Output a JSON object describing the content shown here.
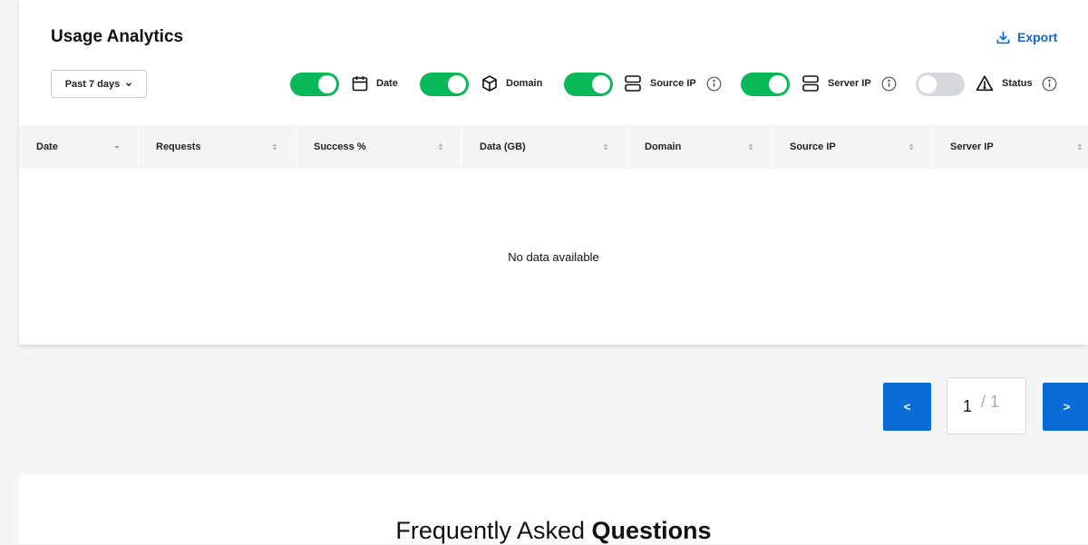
{
  "header": {
    "title": "Usage Analytics",
    "export_label": "Export",
    "accent_color": "#0a6cd8"
  },
  "range": {
    "label": "Past 7 days",
    "icon": "chevron-down-icon"
  },
  "filters": [
    {
      "label": "Date",
      "icon": "calendar-icon",
      "enabled": true,
      "has_info": false
    },
    {
      "label": "Domain",
      "icon": "cube-icon",
      "enabled": true,
      "has_info": false
    },
    {
      "label": "Source IP",
      "icon": "server-icon",
      "enabled": true,
      "has_info": true
    },
    {
      "label": "Server IP",
      "icon": "server-icon",
      "enabled": true,
      "has_info": true
    },
    {
      "label": "Status",
      "icon": "warning-icon",
      "enabled": false,
      "has_info": true
    }
  ],
  "toggle_on_color": "#09b857",
  "toggle_off_color": "#d6d8dc",
  "table": {
    "columns": [
      "Date",
      "Requests",
      "Success %",
      "Data (GB)",
      "Domain",
      "Source IP",
      "Server IP"
    ],
    "empty_text": "No data available"
  },
  "pagination": {
    "prev_label": "<",
    "next_label": ">",
    "current_page": "1",
    "total_pages": "/ 1"
  },
  "faq": {
    "title_regular": "Frequently Asked",
    "title_bold": "Questions"
  }
}
